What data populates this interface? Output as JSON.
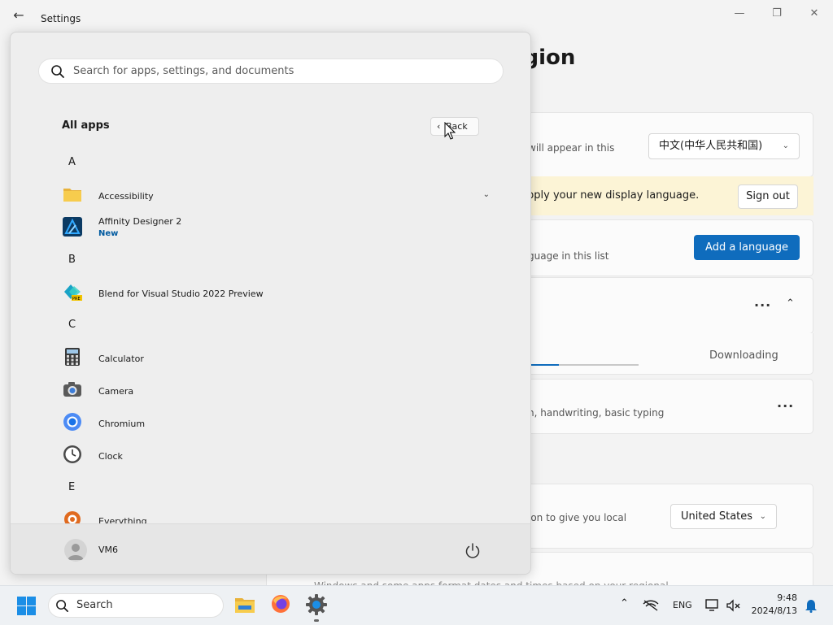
{
  "window": {
    "title": "Settings",
    "back_icon": "arrow-left-icon",
    "controls": [
      "minimize-icon",
      "maximize-icon",
      "close-icon"
    ]
  },
  "page": {
    "title": "Language & region",
    "visible_title": "uage & region",
    "display_language_desc": "will appear in this",
    "display_language_value": "中文(中华人民共和国)",
    "banner_text": "pply your new display language.",
    "signout_label": "Sign out",
    "preferred_desc": "guage in this list",
    "add_language_label": "Add a language",
    "downloading_label": "Downloading",
    "download_progress_pct": 47,
    "features_desc": "n, handwriting, basic typing",
    "country_desc": "ion to give you local",
    "country_value": "United States",
    "regional_format_text": "Windows and some apps format dates and times based on your regional"
  },
  "start_menu": {
    "search_placeholder": "Search for apps, settings, and documents",
    "all_apps_label": "All apps",
    "back_label": "Back",
    "sections": [
      {
        "letter": "A"
      },
      {
        "letter": "B"
      },
      {
        "letter": "C"
      },
      {
        "letter": "E"
      }
    ],
    "apps": [
      {
        "name": "Accessibility",
        "icon": "folder-icon",
        "expandable": true
      },
      {
        "name": "Affinity Designer 2",
        "icon": "affinity-designer-icon",
        "badge": "New"
      },
      {
        "name": "Blend for Visual Studio 2022 Preview",
        "icon": "blend-vs-icon"
      },
      {
        "name": "Calculator",
        "icon": "calculator-icon"
      },
      {
        "name": "Camera",
        "icon": "camera-icon"
      },
      {
        "name": "Chromium",
        "icon": "chromium-icon"
      },
      {
        "name": "Clock",
        "icon": "clock-icon"
      },
      {
        "name": "Everything",
        "icon": "everything-icon"
      }
    ],
    "user": {
      "name": "VM6"
    },
    "power_icon": "power-icon"
  },
  "taskbar": {
    "search_label": "Search",
    "pinned": [
      "file-explorer-icon",
      "firefox-icon",
      "settings-icon"
    ],
    "language_indicator": "ENG",
    "time": "9:48",
    "date": "2024/8/13"
  },
  "colors": {
    "accent": "#0f6cbd",
    "banner": "#fcf4d6",
    "badge_new": "#005aa0"
  }
}
